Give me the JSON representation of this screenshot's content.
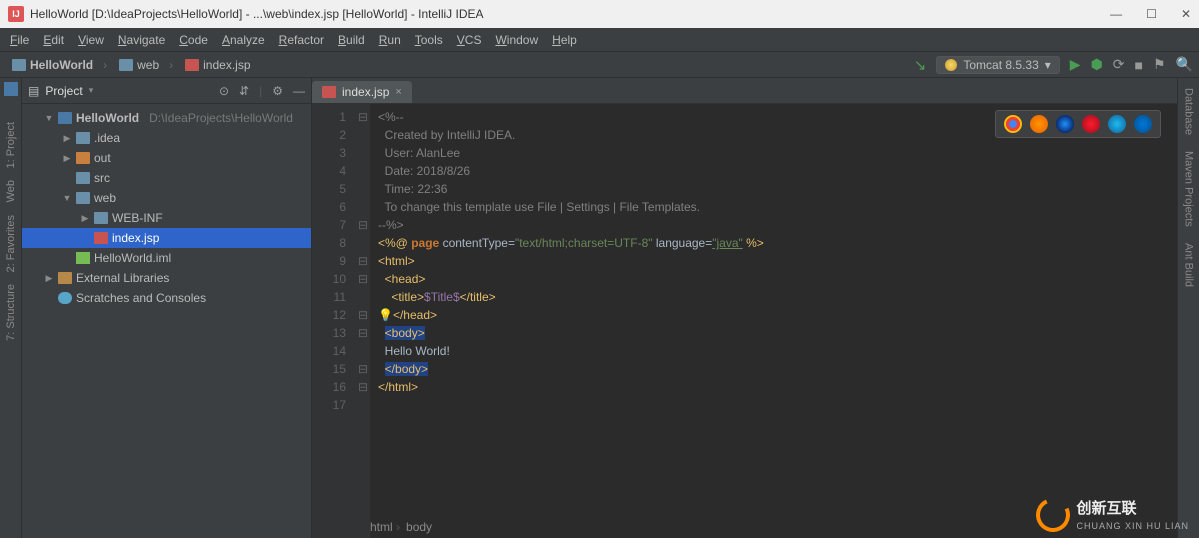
{
  "title": "HelloWorld [D:\\IdeaProjects\\HelloWorld] - ...\\web\\index.jsp [HelloWorld] - IntelliJ IDEA",
  "menu": [
    "File",
    "Edit",
    "View",
    "Navigate",
    "Code",
    "Analyze",
    "Refactor",
    "Build",
    "Run",
    "Tools",
    "VCS",
    "Window",
    "Help"
  ],
  "breadcrumbs": [
    {
      "icon": "folder-blue",
      "text": "HelloWorld"
    },
    {
      "icon": "folder-blue",
      "text": "web"
    },
    {
      "icon": "jsp",
      "text": "index.jsp"
    }
  ],
  "run_config": {
    "label": "Tomcat 8.5.33",
    "dropdown": "▾"
  },
  "left_tools": [
    "1: Project",
    "Web",
    "2: Favorites",
    "7: Structure"
  ],
  "right_tools": [
    "Database",
    "Maven Projects",
    "Ant Build"
  ],
  "project_pane": {
    "title": "Project",
    "root": {
      "name": "HelloWorld",
      "hint": "D:\\IdeaProjects\\HelloWorld"
    },
    "tree": [
      {
        "indent": 1,
        "arrow": "▼",
        "icon": "pkg",
        "name": "HelloWorld",
        "hint": "D:\\IdeaProjects\\HelloWorld",
        "bold": true
      },
      {
        "indent": 2,
        "arrow": "▶",
        "icon": "folder",
        "name": ".idea"
      },
      {
        "indent": 2,
        "arrow": "▶",
        "icon": "folder-orange",
        "name": "out"
      },
      {
        "indent": 2,
        "arrow": "",
        "icon": "folder",
        "name": "src"
      },
      {
        "indent": 2,
        "arrow": "▼",
        "icon": "folder",
        "name": "web"
      },
      {
        "indent": 3,
        "arrow": "▶",
        "icon": "folder",
        "name": "WEB-INF"
      },
      {
        "indent": 3,
        "arrow": "",
        "icon": "jsp",
        "name": "index.jsp",
        "sel": true
      },
      {
        "indent": 2,
        "arrow": "",
        "icon": "iml",
        "name": "HelloWorld.iml"
      },
      {
        "indent": 1,
        "arrow": "▶",
        "icon": "lib",
        "name": "External Libraries"
      },
      {
        "indent": 1,
        "arrow": "",
        "icon": "scratch",
        "name": "Scratches and Consoles"
      }
    ]
  },
  "tab": {
    "name": "index.jsp"
  },
  "line_count": 17,
  "code": {
    "l1": "<%--",
    "l2": "  Created by IntelliJ IDEA.",
    "l3": "  User: AlanLee",
    "l4": "  Date: 2018/8/26",
    "l5": "  Time: 22:36",
    "l6": "  To change this template use File | Settings | File Templates.",
    "l7": "--%>",
    "page_kw": "page",
    "ct_attr": "contentType=",
    "ct_val": "\"text/html;charset=UTF-8\"",
    "lang_attr": " language=",
    "lang_val": "\"java\"",
    "html_open": "<html>",
    "head_open": "<head>",
    "title_open": "<title>",
    "title_var": "$Title$",
    "title_close": "</title>",
    "head_close": "</head>",
    "body_open": "<body>",
    "hello": "Hello World!",
    "body_close": "</body>",
    "html_close": "</html>"
  },
  "breadcrumbs_bottom": [
    "html",
    "body"
  ],
  "watermark": {
    "big": "创新互联",
    "small": "CHUANG XIN HU LIAN"
  },
  "browsers": [
    "chrome",
    "firefox",
    "safari",
    "opera",
    "ie",
    "edge"
  ]
}
